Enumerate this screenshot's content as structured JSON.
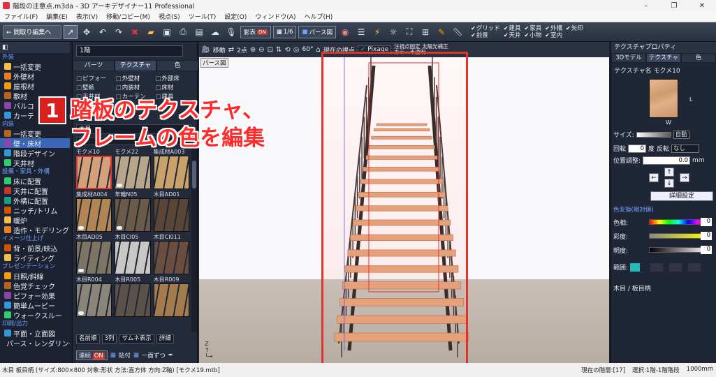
{
  "window": {
    "title": "階段の注意点.m3da - 3D アーキデザイナー11 Professional"
  },
  "menu": [
    "ファイル(F)",
    "編集(E)",
    "表示(V)",
    "移動/コピー(M)",
    "視点(S)",
    "ツール(T)",
    "設定(O)",
    "ウィンドウ(A)",
    "ヘルプ(H)"
  ],
  "toolbar": {
    "back_label": "← 間取り編集へ",
    "zoom": "1/6",
    "shadow_label": "影表",
    "shadow_on": "ON",
    "pers_label": "パース図",
    "checks": [
      "グリッド",
      "建具",
      "家具",
      "外構",
      "矢印",
      "前景",
      "天井",
      "小物",
      "室内"
    ]
  },
  "leftnav": {
    "sections": [
      {
        "title": "外装",
        "items": [
          "一括変更",
          "外壁材",
          "屋根材",
          "敷材",
          "バルコ",
          "カーテ"
        ]
      },
      {
        "title": "内装",
        "items": [
          "一括変更",
          "壁・床材",
          "階段デザイン",
          "天井材"
        ]
      },
      {
        "title": "設備・家具・外構",
        "items": [
          "床に配置",
          "天井に配置",
          "外構に配置",
          "ニッチ/トリム",
          "暖炉",
          "造作・モデリング"
        ]
      },
      {
        "title": "イメージ仕上げ",
        "items": [
          "背・前景/映込",
          "ライティング"
        ]
      },
      {
        "title": "プレゼンテーション",
        "items": [
          "日照/斜線",
          "色覚チェック",
          "ピフォー効果",
          "簡単ムービー",
          "ウォークスルー"
        ]
      },
      {
        "title": "印刷/出力",
        "items": [
          "平面・立面図",
          "パース・レンダリング"
        ]
      }
    ],
    "active_item": "壁・床材"
  },
  "material_panel": {
    "floor_select": "1階",
    "tabs": [
      "パーツ",
      "テクスチャ",
      "色"
    ],
    "active_tab": "テクスチャ",
    "categories": [
      "ピフォー",
      "外壁材",
      "外部床",
      "壁紙",
      "内装材",
      "床材",
      "天井材",
      "カーテン",
      "建具"
    ],
    "sort": "木目",
    "swatches": [
      {
        "name": "モクメ10",
        "color": "#d4a07a"
      },
      {
        "name": "モクメ22",
        "color": "#b9a58c"
      },
      {
        "name": "集成材A003",
        "color": "#c9a16a"
      },
      {
        "name": "集成材A004",
        "color": "#b28554"
      },
      {
        "name": "年輪N05",
        "color": "#6b5a4a"
      },
      {
        "name": "木目AD01",
        "color": "#5a4536"
      },
      {
        "name": "木目AD05",
        "color": "#7d7466"
      },
      {
        "name": "木目CI05",
        "color": "#c9c7c3"
      },
      {
        "name": "木目CI011",
        "color": "#6a4f40"
      },
      {
        "name": "木目R004",
        "color": "#8a8479"
      },
      {
        "name": "木目R005",
        "color": "#5b5149"
      },
      {
        "name": "木目R009",
        "color": "#a47b4d"
      }
    ],
    "sort_label": "名前順",
    "columns": "3列",
    "thumb_check": "サムネ表示",
    "detail": "詳細",
    "continuous": "連続",
    "continuous_on": "ON",
    "paste_label": "貼付",
    "batch_label": "一面ずつ"
  },
  "view_toolbar": {
    "move": "移動",
    "points": "2点",
    "angle": "60°",
    "viewpoint": "現在の視点",
    "renderer": "Pixage",
    "options": [
      "注視点固定",
      "太陽光補正",
      "カラー半透明"
    ]
  },
  "viewport": {
    "label": "パース図",
    "axis": "Z"
  },
  "annotation": {
    "number": "1",
    "line1": "踏板のテクスチャ、",
    "line2": "フレームの色を編集"
  },
  "right_panel": {
    "title": "テクスチャプロパティ",
    "tabs": [
      "3Dモデル",
      "テクスチャ",
      "色"
    ],
    "active_tab": "テクスチャ",
    "texture_name": "テクスチャ名 モクメ10",
    "thumb_w": "W",
    "thumb_l": "L",
    "size_label": "サイズ:",
    "size_auto": "自動",
    "rotate_label": "回転",
    "rotate_value": "0",
    "rotate_unit": "度",
    "flip_label": "反転",
    "flip_value": "なし",
    "position_label": "位置調整:",
    "position_value": "0.0",
    "position_unit": "mm",
    "detail_button": "詳細設定",
    "color_head": "色変換(相対値)",
    "hue_label": "色相:",
    "hue_value": "0",
    "sat_label": "彩度:",
    "sat_value": "0",
    "bright_label": "明度:",
    "bright_value": "0",
    "range_label": "範囲:",
    "category": "木目 / 板目柄"
  },
  "status": {
    "left": "木目 板目柄 (サイズ:800×800 対象:形状 方法:直方体 方向:Z軸) [モクメ19.mtb]",
    "floor": "現在の階層:[17]",
    "select": "選択:1階-1階階段",
    "unit": "1000mm"
  }
}
